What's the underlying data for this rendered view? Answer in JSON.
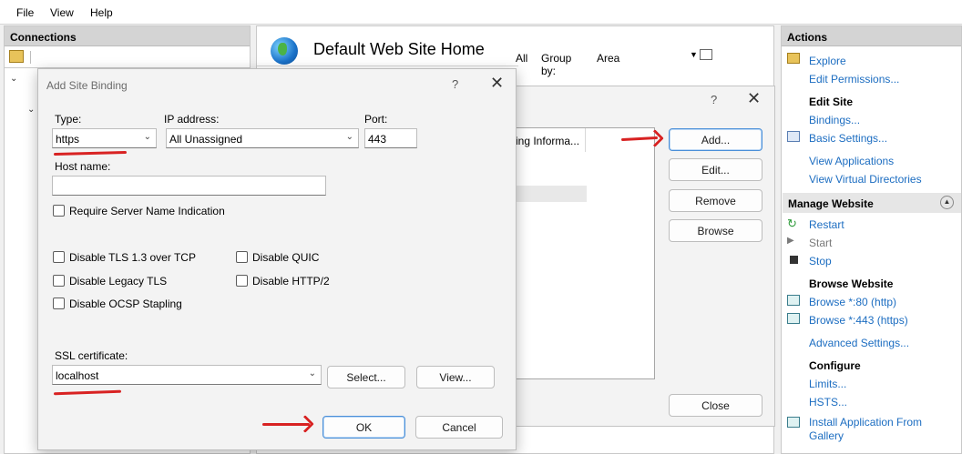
{
  "menu": {
    "file": "File",
    "view": "View",
    "help": "Help"
  },
  "connections": {
    "title": "Connections"
  },
  "center": {
    "title": "Default Web Site Home",
    "filter_all": "All",
    "group_by": "Group by:",
    "group_value": "Area"
  },
  "edit_bindings": {
    "help": "?",
    "close_x": "✕",
    "column_fragment": "ing Informa...",
    "add": "Add...",
    "edit": "Edit...",
    "remove": "Remove",
    "browse": "Browse",
    "close": "Close"
  },
  "dialog": {
    "title": "Add Site Binding",
    "help": "?",
    "close_x": "✕",
    "type_label": "Type:",
    "type_value": "https",
    "ip_label": "IP address:",
    "ip_value": "All Unassigned",
    "port_label": "Port:",
    "port_value": "443",
    "host_label": "Host name:",
    "host_value": "",
    "sni": "Require Server Name Indication",
    "tls13": "Disable TLS 1.3 over TCP",
    "quic": "Disable QUIC",
    "legacy_tls": "Disable Legacy TLS",
    "http2": "Disable HTTP/2",
    "ocsp": "Disable OCSP Stapling",
    "ssl_label": "SSL certificate:",
    "ssl_value": "localhost",
    "select": "Select...",
    "view": "View...",
    "ok": "OK",
    "cancel": "Cancel"
  },
  "actions": {
    "title": "Actions",
    "explore": "Explore",
    "edit_permissions": "Edit Permissions...",
    "edit_site": "Edit Site",
    "bindings": "Bindings...",
    "basic_settings": "Basic Settings...",
    "view_applications": "View Applications",
    "view_virtual_directories": "View Virtual Directories",
    "manage_website": "Manage Website",
    "restart": "Restart",
    "start": "Start",
    "stop": "Stop",
    "browse_website": "Browse Website",
    "browse_80": "Browse *:80 (http)",
    "browse_443": "Browse *:443 (https)",
    "advanced_settings": "Advanced Settings...",
    "configure": "Configure",
    "limits": "Limits...",
    "hsts": "HSTS...",
    "install_line1": "Install Application From",
    "install_line2": "Gallery"
  },
  "colors": {
    "link": "#1c6dc1",
    "annotation": "#d82222",
    "primary_border": "#4a8fd8"
  }
}
